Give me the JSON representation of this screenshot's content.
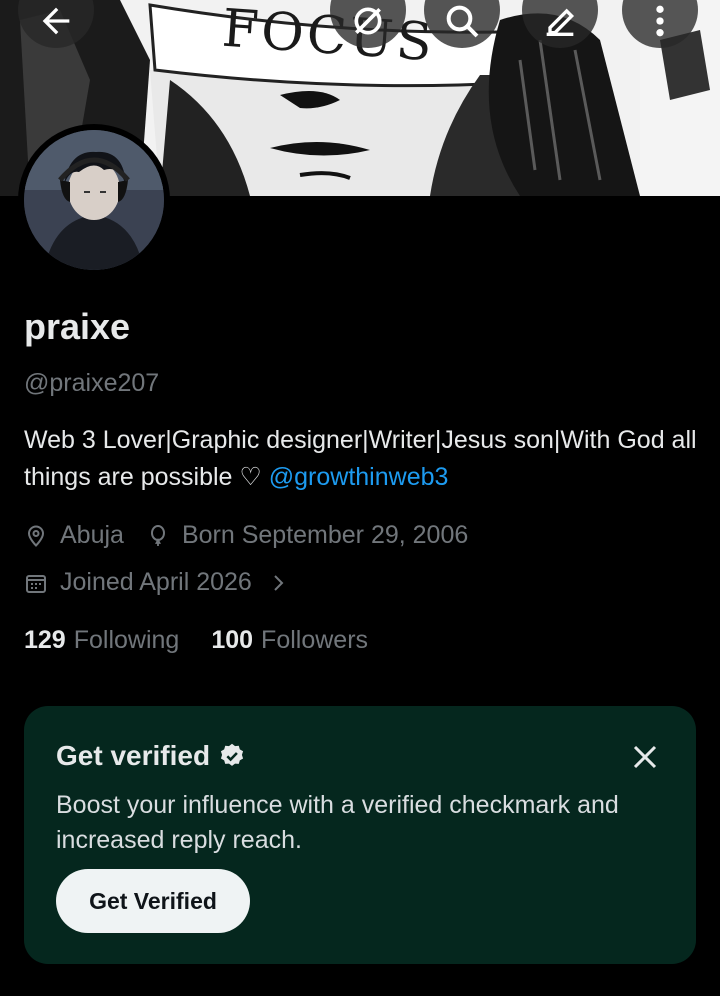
{
  "banner": {
    "text": "FOCUS"
  },
  "profile": {
    "name": "praixe",
    "handle": "@praixe207",
    "bio_text": "Web 3 Lover|Graphic designer|Writer|Jesus son|With God all things are possible ♡ ",
    "bio_mention": "@growthinweb3",
    "location": "Abuja",
    "birthday": "Born September 29, 2006",
    "joined": "Joined April 2026",
    "following_count": "129",
    "following_label": "Following",
    "followers_count": "100",
    "followers_label": "Followers"
  },
  "verify_card": {
    "title": "Get verified",
    "body": "Boost your influence with a verified checkmark and increased reply reach.",
    "button_label": "Get Verified"
  },
  "icons": {
    "back": "arrow-left-icon",
    "grok": "grok-icon",
    "search": "search-icon",
    "edit": "edit-icon",
    "more": "more-vertical-icon",
    "location": "location-pin-icon",
    "birthday": "balloon-icon",
    "calendar": "calendar-icon",
    "chevron": "chevron-right-icon",
    "verified": "verified-badge-icon",
    "close": "close-icon"
  },
  "colors": {
    "background": "#000000",
    "link": "#1d9bf0",
    "muted": "#71767b",
    "card": "#05271e",
    "button": "#eff3f4"
  }
}
